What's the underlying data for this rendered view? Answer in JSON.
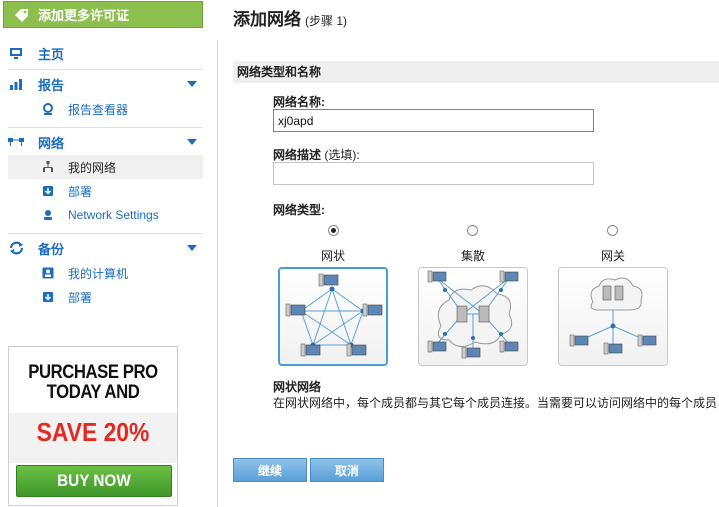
{
  "sidebar": {
    "license_button": "添加更多许可证",
    "home": "主页",
    "reports": {
      "label": "报告",
      "items": [
        "报告查看器"
      ]
    },
    "network": {
      "label": "网络",
      "items": [
        "我的网络",
        "部署",
        "Network Settings"
      ]
    },
    "backup": {
      "label": "备份",
      "items": [
        "我的计算机",
        "部署"
      ]
    },
    "promo": {
      "line1": "PURCHASE PRO",
      "line2": "TODAY AND",
      "line3": "SAVE 20%",
      "button": "BUY NOW"
    }
  },
  "page": {
    "title": "添加网络",
    "step": "(步骤 1)"
  },
  "form": {
    "section_title": "网络类型和名称",
    "name_label": "网络名称:",
    "name_value": "xj0apd",
    "desc_label": "网络描述",
    "desc_optional": "(选填):",
    "desc_value": "",
    "type_label": "网络类型:",
    "types": [
      {
        "label": "网状",
        "selected": true
      },
      {
        "label": "集散",
        "selected": false
      },
      {
        "label": "网关",
        "selected": false
      }
    ],
    "description_title": "网状网络",
    "description_text": "在网状网络中，每个成员都与其它每个成员连接。当需要可以访问网络中的每个成员"
  },
  "buttons": {
    "continue": "继续",
    "cancel": "取消"
  },
  "colors": {
    "accent": "#1a6dbf",
    "license_green": "#8cbf4e",
    "button_blue": "#5a9fd6",
    "promo_red": "#e32a22"
  }
}
